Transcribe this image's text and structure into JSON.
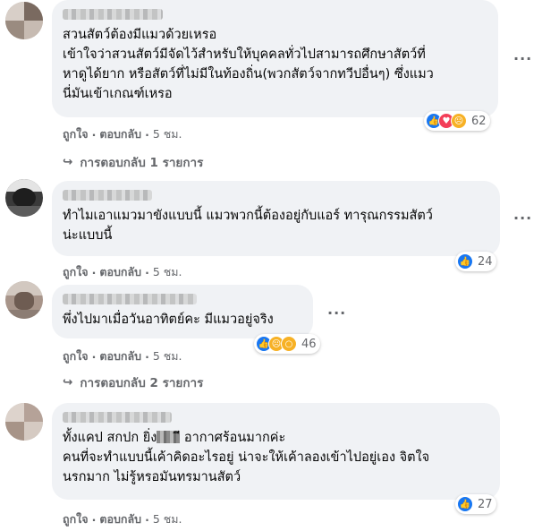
{
  "comments": [
    {
      "text": "สวนสัตว์ต้องมีแมวด้วยเหรอ\nเข้าใจว่าสวนสัตว์มีจัดไว้สำหรับให้บุคคลทั่วไปสามารถศึกษาสัตว์ที่\nหาดูได้ยาก หรือสัตว์ที่ไม่มีในท้องถิ่น(พวกสัตว์จากทวีปอื่นๆ) ซึ่งแมว\nนี่มันเข้าเกณฑ์เหรอ",
      "reaction_count": "62",
      "reaction_icons": [
        "like-icon",
        "love-icon",
        "sad-icon"
      ],
      "like_label": "ถูกใจ",
      "reply_label": "ตอบกลับ",
      "time": "5 ชม.",
      "replies_label": "การตอบกลับ 1 รายการ"
    },
    {
      "text": "ทำไมเอาแมวมาขังแบบนี้ แมวพวกนี้ต้องอยู่กับแอร์ ทารุณกรรมสัตว์\nน่ะแบบนี้",
      "reaction_count": "24",
      "reaction_icons": [
        "like-icon"
      ],
      "like_label": "ถูกใจ",
      "reply_label": "ตอบกลับ",
      "time": "5 ชม."
    },
    {
      "text": "พึ่งไปมาเมื่อวันอาทิตย์คะ มีแมวอยู่จริง",
      "reaction_count": "46",
      "reaction_icons": [
        "like-icon",
        "sad-icon",
        "wow-icon"
      ],
      "like_label": "ถูกใจ",
      "reply_label": "ตอบกลับ",
      "time": "5 ชม.",
      "replies_label": "การตอบกลับ 2 รายการ"
    },
    {
      "text_before": "ทั้งแคป สกปก ยิ่ง",
      "text_after": "ี อากาศร้อนมากค่ะ\nคนที่จะทำแบบนี้เค้าคิดอะไรอยู่ น่าจะให้เค้าลองเข้าไปอยู่เอง จิตใจ\nนรกมาก ไม่รู้หรอมันทรมานสัตว์",
      "reaction_count": "27",
      "reaction_icons": [
        "like-icon"
      ],
      "like_label": "ถูกใจ",
      "reply_label": "ตอบกลับ",
      "time": "5 ชม."
    }
  ],
  "separator": "·",
  "colors": {
    "bubble": "#f0f2f5",
    "meta": "#65676b",
    "like": "#1877f2",
    "love": "#f33e58",
    "sad": "#f7b125"
  }
}
